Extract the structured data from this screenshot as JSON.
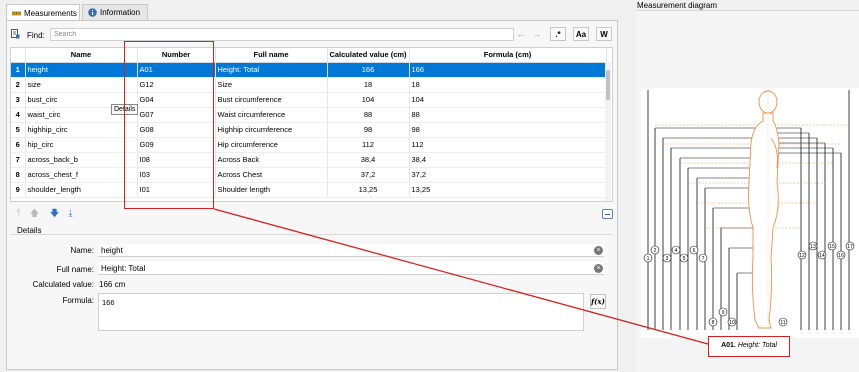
{
  "tabs": [
    {
      "label": "Measurements",
      "icon": "ruler-icon"
    },
    {
      "label": "Information",
      "icon": "info-icon"
    }
  ],
  "find": {
    "label": "Find:",
    "placeholder": "Search"
  },
  "toolbar": {
    "regex_label": ".*",
    "case_label": "Aa",
    "word_label": "W"
  },
  "table": {
    "headers": [
      "Name",
      "Number",
      "Full name",
      "Calculated value (cm)",
      "Formula (cm)"
    ],
    "rows": [
      {
        "n": "1",
        "name": "height",
        "number": "A01",
        "full": "Height: Total",
        "calc": "166",
        "formula": "166"
      },
      {
        "n": "2",
        "name": "size",
        "number": "G12",
        "full": "Size",
        "calc": "18",
        "formula": "18"
      },
      {
        "n": "3",
        "name": "bust_circ",
        "number": "G04",
        "full": "Bust circumference",
        "calc": "104",
        "formula": "104"
      },
      {
        "n": "4",
        "name": "waist_circ",
        "number": "G07",
        "full": "Waist circumference",
        "calc": "88",
        "formula": "88"
      },
      {
        "n": "5",
        "name": "highhip_circ",
        "number": "G08",
        "full": "Highhip circumference",
        "calc": "98",
        "formula": "98"
      },
      {
        "n": "6",
        "name": "hip_circ",
        "number": "G09",
        "full": "Hip circumference",
        "calc": "112",
        "formula": "112"
      },
      {
        "n": "7",
        "name": "across_back_b",
        "number": "I08",
        "full": "Across Back",
        "calc": "38,4",
        "formula": "38,4"
      },
      {
        "n": "8",
        "name": "across_chest_f",
        "number": "I03",
        "full": "Across Chest",
        "calc": "37,2",
        "formula": "37,2"
      },
      {
        "n": "9",
        "name": "shoulder_length",
        "number": "I01",
        "full": "Shoulder length",
        "calc": "13,25",
        "formula": "13,25"
      }
    ],
    "selected_row": 1
  },
  "tooltip": "Details",
  "details": {
    "group_label": "Details",
    "name_label": "Name:",
    "name_value": "height",
    "fullname_label": "Full name:",
    "fullname_value": "Height: Total",
    "calc_label": "Calculated value:",
    "calc_value": "166 cm",
    "formula_label": "Formula:",
    "formula_value": "166",
    "fx_label": "f(x)"
  },
  "diagram": {
    "title": "Measurement diagram",
    "caption_code": "A01.",
    "caption_name": "Height: Total",
    "markers_left": [
      "1",
      "2",
      "3",
      "4",
      "5",
      "6",
      "7"
    ],
    "markers_right": [
      "12",
      "13",
      "14",
      "15",
      "16",
      "17"
    ],
    "markers_bottom": [
      "8",
      "9",
      "10",
      "11"
    ]
  },
  "colors": {
    "selection": "#0078d7",
    "annotation": "#d32020",
    "figure": "#e8944a"
  }
}
